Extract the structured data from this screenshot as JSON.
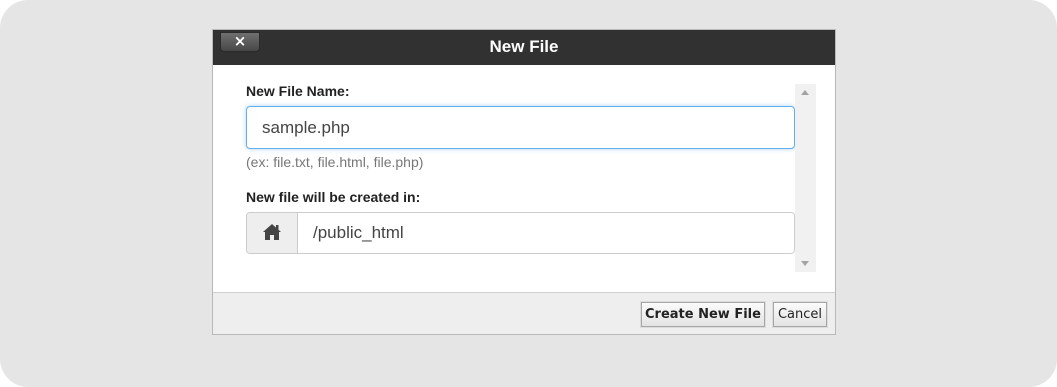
{
  "dialog": {
    "title": "New File",
    "close_label": "×"
  },
  "form": {
    "name_label": "New File Name:",
    "name_value": "sample.php",
    "name_hint": "(ex: file.txt, file.html, file.php)",
    "location_label": "New file will be created in:",
    "location_value": "/public_html",
    "location_icon": "home-icon"
  },
  "footer": {
    "create_label": "Create New File",
    "cancel_label": "Cancel"
  },
  "colors": {
    "titlebar": "#313131",
    "focus_border": "#66afe9",
    "backdrop": "#e5e5e5"
  }
}
